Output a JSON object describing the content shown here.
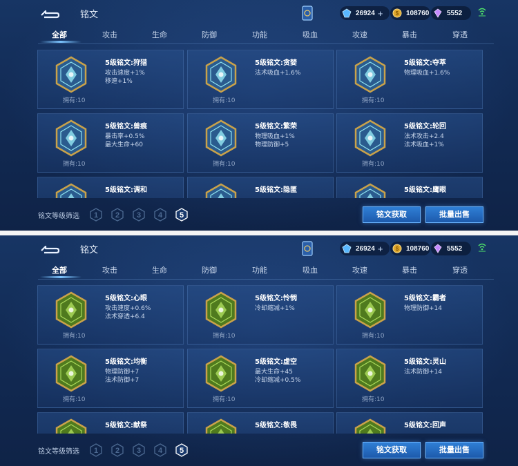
{
  "colors": {
    "accent": "#7cc4ff",
    "blue_rune_stroke": "#7ec8e3",
    "green_rune_fill": "#6f9a2f",
    "gold_frame": "#c9a24a"
  },
  "screens": [
    {
      "header": {
        "title": "铭文",
        "currencies": [
          {
            "icon": "diamond-icon",
            "value": "26924",
            "plus": "+"
          },
          {
            "icon": "gold-coin-icon",
            "value": "108760"
          },
          {
            "icon": "crystal-icon",
            "value": "5552"
          }
        ]
      },
      "tabs": [
        "全部",
        "攻击",
        "生命",
        "防御",
        "功能",
        "吸血",
        "攻速",
        "暴击",
        "穿透"
      ],
      "active_tab": 0,
      "cards": [
        {
          "name": "5级铭文:狩猎",
          "attrs": [
            "攻击速度+1%",
            "移速+1%"
          ],
          "owned": "拥有:10",
          "rune_color": "blue"
        },
        {
          "name": "5级铭文:贪婪",
          "attrs": [
            "法术吸血+1.6%"
          ],
          "owned": "拥有:10",
          "rune_color": "blue"
        },
        {
          "name": "5级铭文:夺萃",
          "attrs": [
            "物理吸血+1.6%"
          ],
          "owned": "拥有:10",
          "rune_color": "blue"
        },
        {
          "name": "5级铭文:兽痕",
          "attrs": [
            "暴击率+0.5%",
            "最大生命+60"
          ],
          "owned": "拥有:10",
          "rune_color": "blue"
        },
        {
          "name": "5级铭文:繁荣",
          "attrs": [
            "物理吸血+1%",
            "物理防御+5"
          ],
          "owned": "拥有:10",
          "rune_color": "blue"
        },
        {
          "name": "5级铭文:轮回",
          "attrs": [
            "法术攻击+2.4",
            "法术吸血+1%"
          ],
          "owned": "拥有:10",
          "rune_color": "blue"
        },
        {
          "name": "5级铭文:调和",
          "attrs": [],
          "owned": "",
          "rune_color": "blue"
        },
        {
          "name": "5级铭文:隐匿",
          "attrs": [],
          "owned": "",
          "rune_color": "blue"
        },
        {
          "name": "5级铭文:鹰眼",
          "attrs": [],
          "owned": "",
          "rune_color": "blue"
        }
      ],
      "filter": {
        "label": "铭文等级筛选",
        "levels": [
          "1",
          "2",
          "3",
          "4",
          "5"
        ],
        "active_level": "5"
      },
      "buttons": {
        "get": "铭文获取",
        "sell": "批量出售"
      }
    },
    {
      "header": {
        "title": "铭文",
        "currencies": [
          {
            "icon": "diamond-icon",
            "value": "26924",
            "plus": "+"
          },
          {
            "icon": "gold-coin-icon",
            "value": "108760"
          },
          {
            "icon": "crystal-icon",
            "value": "5552"
          }
        ]
      },
      "tabs": [
        "全部",
        "攻击",
        "生命",
        "防御",
        "功能",
        "吸血",
        "攻速",
        "暴击",
        "穿透"
      ],
      "active_tab": 0,
      "cards": [
        {
          "name": "5级铭文:心眼",
          "attrs": [
            "攻击速度+0.6%",
            "法术穿透+6.4"
          ],
          "owned": "拥有:10",
          "rune_color": "green"
        },
        {
          "name": "5级铭文:怜悯",
          "attrs": [
            "冷却缩减+1%"
          ],
          "owned": "拥有:10",
          "rune_color": "green"
        },
        {
          "name": "5级铭文:霸者",
          "attrs": [
            "物理防御+14"
          ],
          "owned": "拥有:10",
          "rune_color": "green"
        },
        {
          "name": "5级铭文:均衡",
          "attrs": [
            "物理防御+7",
            "法术防御+7"
          ],
          "owned": "拥有:10",
          "rune_color": "green"
        },
        {
          "name": "5级铭文:虚空",
          "attrs": [
            "最大生命+45",
            "冷却缩减+0.5%"
          ],
          "owned": "拥有:10",
          "rune_color": "green"
        },
        {
          "name": "5级铭文:灵山",
          "attrs": [
            "法术防御+14"
          ],
          "owned": "拥有:10",
          "rune_color": "green"
        },
        {
          "name": "5级铭文:献祭",
          "attrs": [],
          "owned": "",
          "rune_color": "green"
        },
        {
          "name": "5级铭文:敬畏",
          "attrs": [],
          "owned": "",
          "rune_color": "green"
        },
        {
          "name": "5级铭文:回声",
          "attrs": [],
          "owned": "",
          "rune_color": "green"
        }
      ],
      "filter": {
        "label": "铭文等级筛选",
        "levels": [
          "1",
          "2",
          "3",
          "4",
          "5"
        ],
        "active_level": "5"
      },
      "buttons": {
        "get": "铭文获取",
        "sell": "批量出售"
      }
    }
  ]
}
